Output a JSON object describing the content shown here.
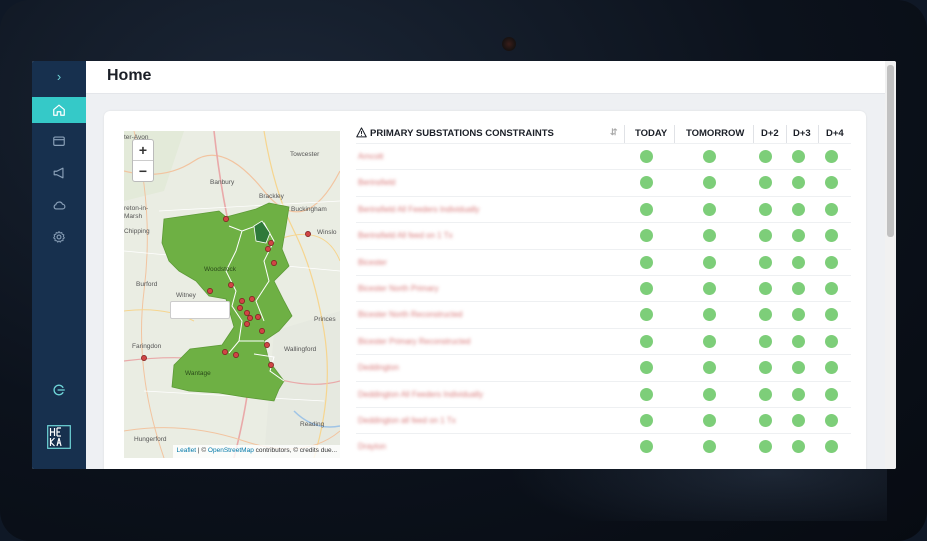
{
  "page": {
    "title": "Home"
  },
  "sidebar": {
    "items": [
      {
        "icon": "chevron-right-icon"
      },
      {
        "icon": "home-icon",
        "active": true
      },
      {
        "icon": "wallet-icon"
      },
      {
        "icon": "megaphone-icon"
      },
      {
        "icon": "cloud-icon"
      },
      {
        "icon": "gear-icon"
      },
      {
        "icon": "logout-icon"
      }
    ],
    "logo_text": "HEKA"
  },
  "map": {
    "zoom_in": "+",
    "zoom_out": "−",
    "attribution_leaflet": "Leaflet",
    "attribution_sep": " | © ",
    "attribution_osm": "OpenStreetMap",
    "attribution_rest": " contributors, © credits due...",
    "place_labels": [
      "ter-Avon",
      "Towcester",
      "Banbury",
      "Brackley",
      "Buckingham",
      "reton-in-Marsh",
      "Chipping Norton",
      "Winslo",
      "Woodstock",
      "Burford",
      "Witney",
      "Princes",
      "Faringdon",
      "Wallingford",
      "Wantage",
      "Reading",
      "Hungerford"
    ]
  },
  "table": {
    "header_title": "PRIMARY SUBSTATIONS CONSTRAINTS",
    "warning_icon": "warning-triangle-icon",
    "columns": [
      "TODAY",
      "TOMORROW",
      "D+2",
      "D+3",
      "D+4"
    ],
    "rows": [
      "Arncott",
      "Berinsfield",
      "Berinsfield All Feeders Individually",
      "Berinsfield All feed on 1 Tx",
      "Bicester",
      "Bicester North Primary",
      "Bicester North Reconstructed",
      "Bicester Primary Reconstructed",
      "Deddington",
      "Deddington All Feeders Individually",
      "Deddington all feed on 1 Tx",
      "Drayton"
    ],
    "status_color": "#7dce79"
  }
}
